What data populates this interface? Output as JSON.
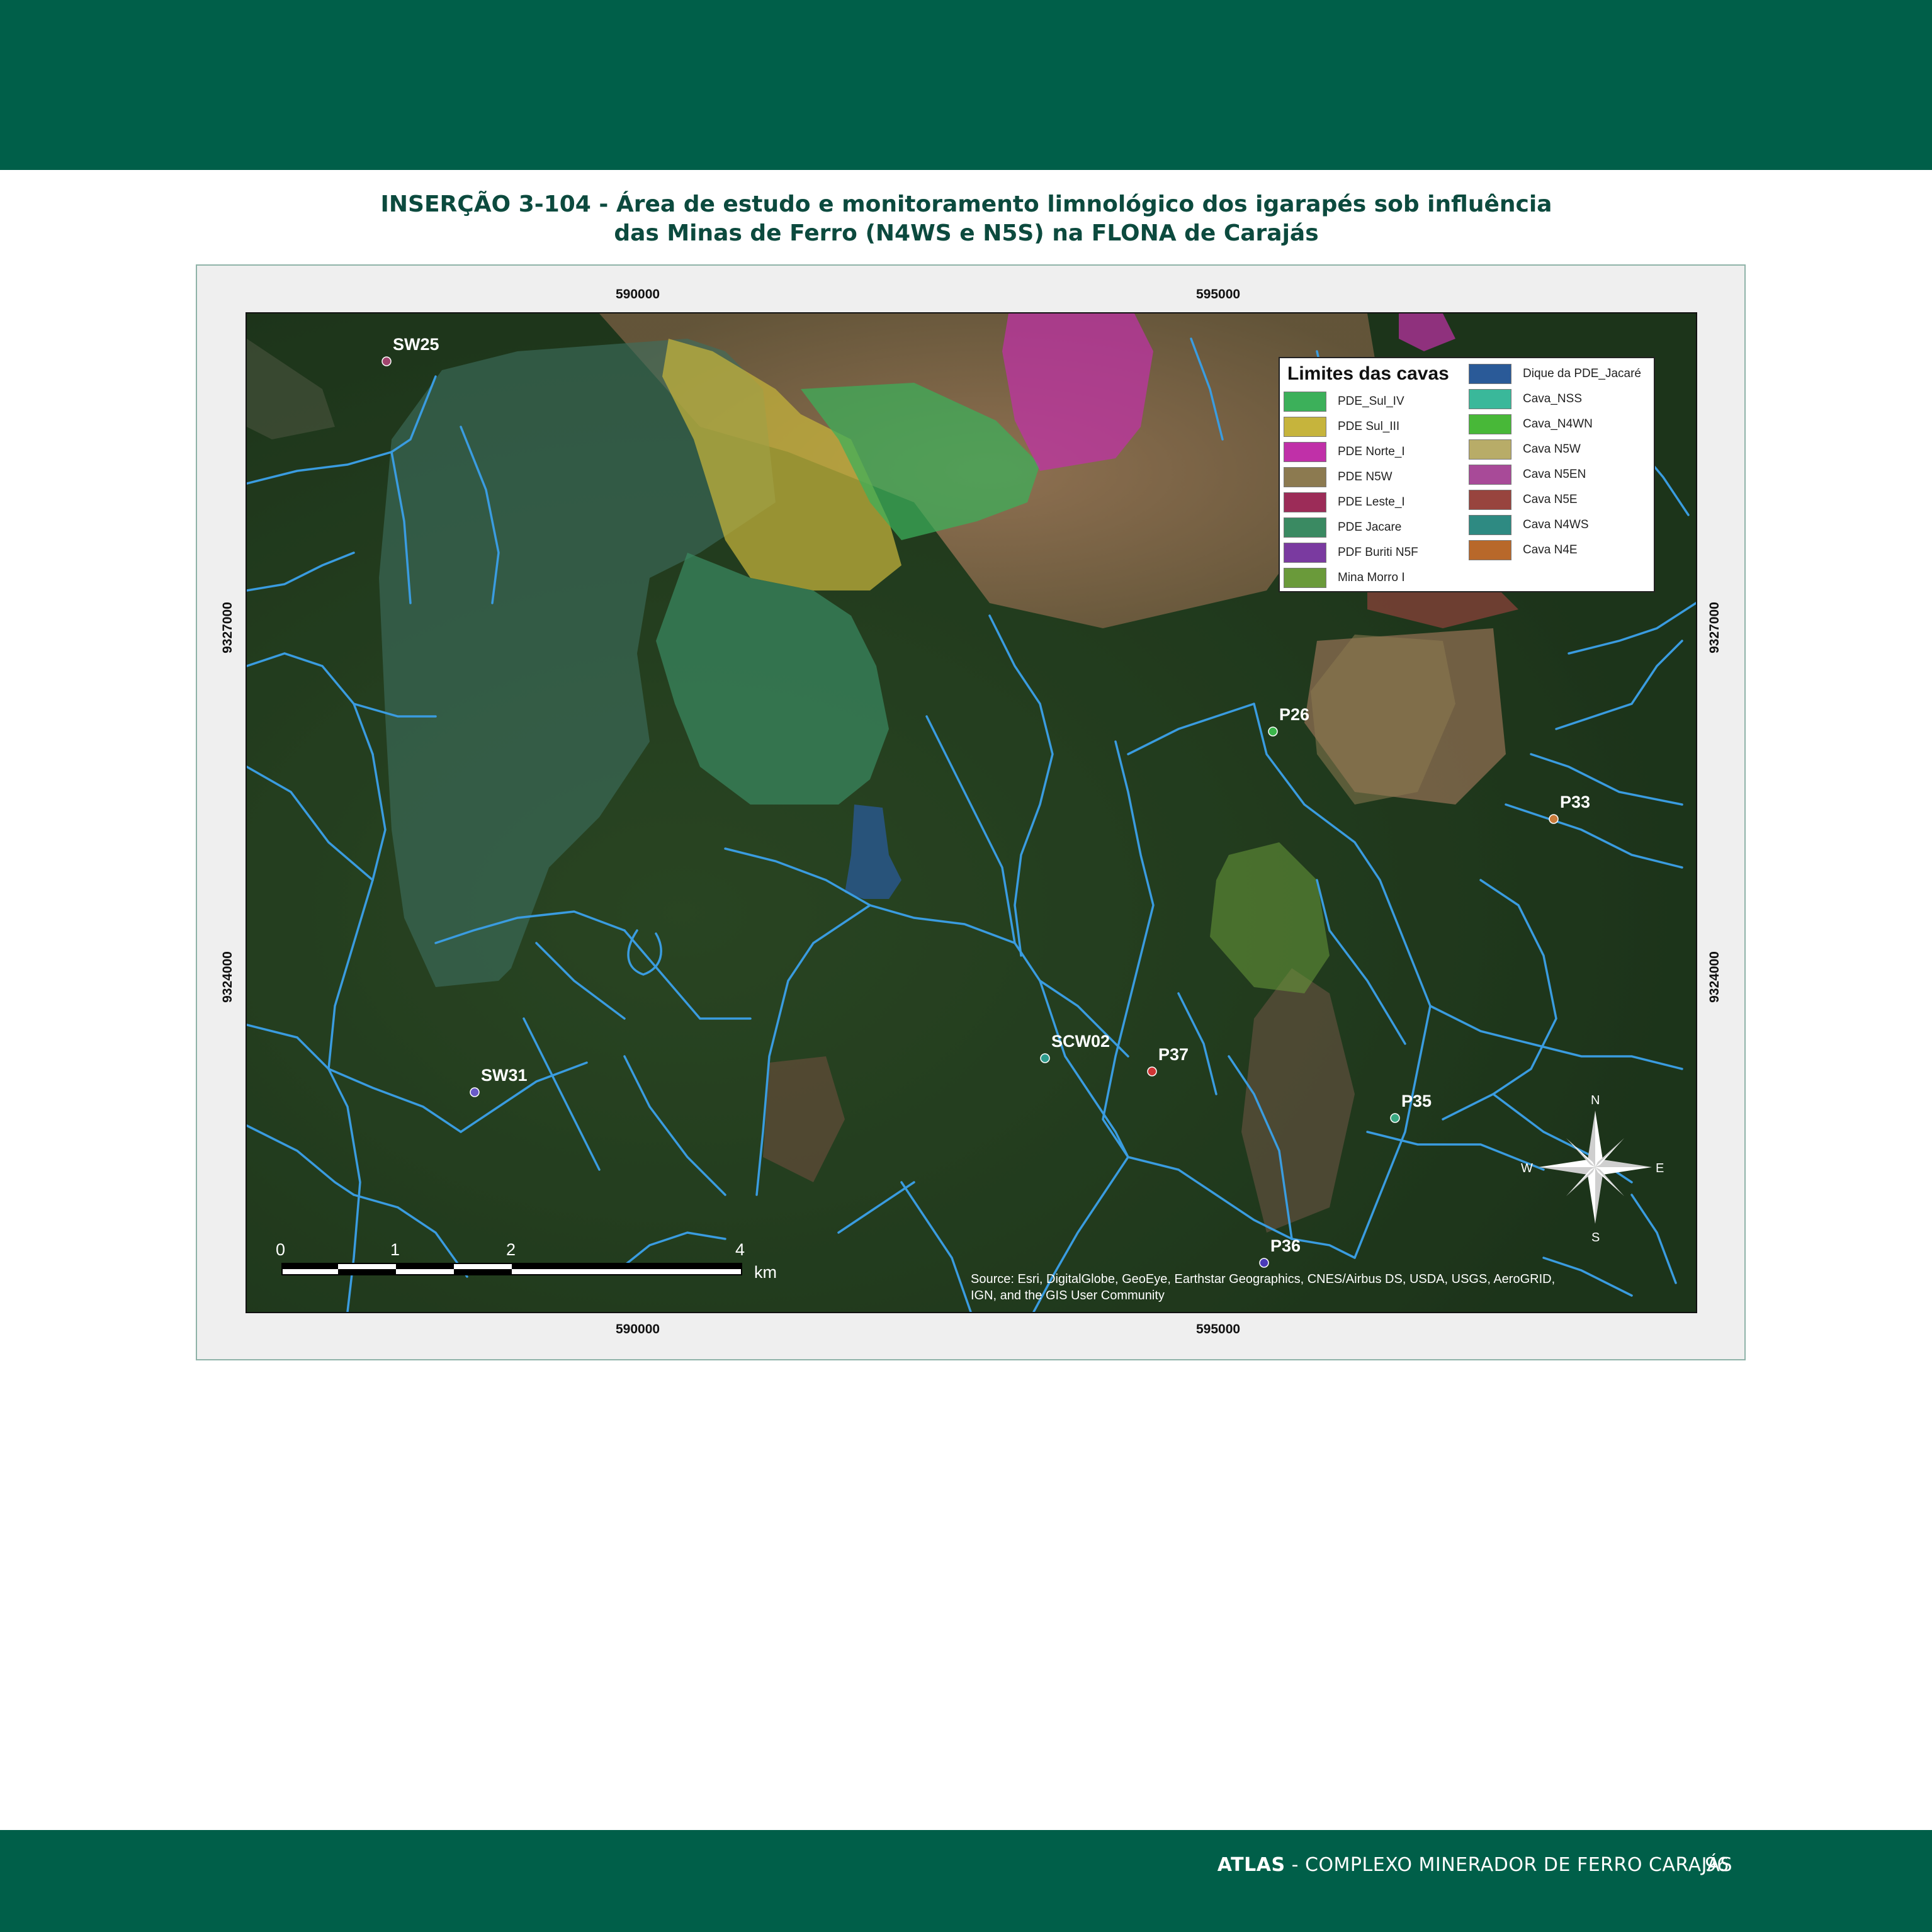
{
  "caption": {
    "line1": "INSERÇÃO 3-104 - Área de estudo e monitoramento limnológico dos igarapés sob influência",
    "line2": "das Minas de Ferro (N4WS e N5S) na FLONA de Carajás"
  },
  "footer": {
    "brand": "ATLAS",
    "subtitle": " - COMPLEXO MINERADOR DE FERRO CARAJÁS",
    "page_number": "96"
  },
  "map": {
    "x_labels": [
      "590000",
      "595000"
    ],
    "y_labels": [
      "9327000",
      "9324000"
    ],
    "stations": [
      {
        "name": "SW25",
        "color": "#a0456e"
      },
      {
        "name": "P26",
        "color": "#3bb54a"
      },
      {
        "name": "P33",
        "color": "#c87a3a"
      },
      {
        "name": "SCW02",
        "color": "#2e9c8e"
      },
      {
        "name": "P37",
        "color": "#d03535"
      },
      {
        "name": "SW31",
        "color": "#6a5ac8"
      },
      {
        "name": "P35",
        "color": "#3aa882"
      },
      {
        "name": "P36",
        "color": "#4a3ab8"
      }
    ],
    "scale_bar": {
      "labels": [
        "0",
        "1",
        "2",
        "4"
      ],
      "unit": "km"
    },
    "north_arrow": {
      "n": "N",
      "s": "S",
      "e": "E",
      "w": "W"
    },
    "attribution": {
      "line1": "Source: Esri, DigitalGlobe, GeoEye, Earthstar Geographics, CNES/Airbus DS, USDA, USGS, AeroGRID,",
      "line2": "IGN, and the GIS User Community"
    }
  },
  "legend": {
    "title": "Limites das cavas",
    "items": [
      {
        "label": "PDE_Sul_IV",
        "color": "#3cb05a"
      },
      {
        "label": "PDE Sul_III",
        "color": "#c6b43c"
      },
      {
        "label": "PDE Norte_I",
        "color": "#c030a8"
      },
      {
        "label": "PDE N5W",
        "color": "#8c7a50"
      },
      {
        "label": "PDE Leste_I",
        "color": "#9c2c58"
      },
      {
        "label": "PDE Jacare",
        "color": "#3a8a62"
      },
      {
        "label": "PDF Buriti N5F",
        "color": "#7a3aa0"
      },
      {
        "label": "Mina Morro I",
        "color": "#6a9a3a"
      },
      {
        "label": "Dique da PDE_Jacaré",
        "color": "#2a5a98"
      },
      {
        "label": "Cava_NSS",
        "color": "#3ab89a"
      },
      {
        "label": "Cava_N4WN",
        "color": "#48b838"
      },
      {
        "label": "Cava N5W",
        "color": "#b8ac68"
      },
      {
        "label": "Cava N5EN",
        "color": "#a84a98"
      },
      {
        "label": "Cava N5E",
        "color": "#98443e"
      },
      {
        "label": "Cava N4WS",
        "color": "#2e8a82"
      },
      {
        "label": "Cava N4E",
        "color": "#b8682a"
      }
    ]
  }
}
